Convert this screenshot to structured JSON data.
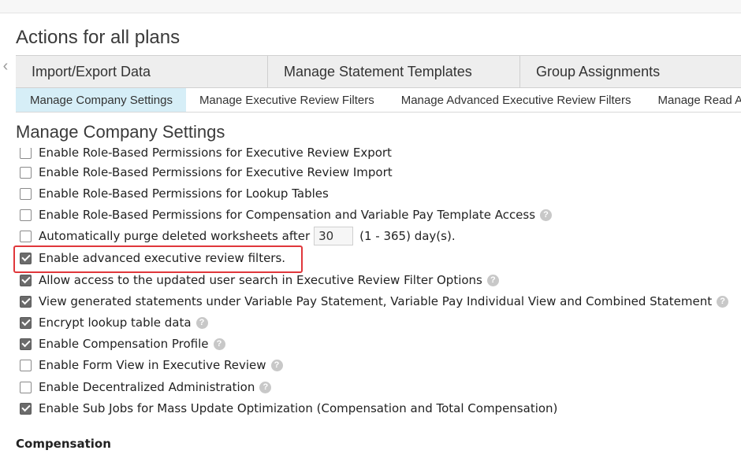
{
  "page": {
    "title": "Actions for all plans",
    "back_glyph": "‹"
  },
  "main_tabs": [
    {
      "label": "Import/Export Data"
    },
    {
      "label": "Manage Statement Templates"
    },
    {
      "label": "Group Assignments"
    }
  ],
  "sub_tabs": [
    {
      "label": "Manage Company Settings",
      "active": true
    },
    {
      "label": "Manage Executive Review Filters",
      "active": false
    },
    {
      "label": "Manage Advanced Executive Review Filters",
      "active": false
    },
    {
      "label": "Manage Read Access",
      "active": false
    }
  ],
  "section": {
    "title": "Manage Company Settings"
  },
  "settings": [
    {
      "label": "Enable Role-Based Permissions for Executive Review Export",
      "checked": false,
      "help": false
    },
    {
      "label": "Enable Role-Based Permissions for Executive Review Import",
      "checked": false,
      "help": false
    },
    {
      "label": "Enable Role-Based Permissions for Lookup Tables",
      "checked": false,
      "help": false
    },
    {
      "label": "Enable Role-Based Permissions for Compensation and Variable Pay Template Access",
      "checked": false,
      "help": true
    },
    {
      "label": "Automatically purge deleted worksheets after",
      "suffix": "(1 - 365) day(s).",
      "input_value": "30",
      "checked": false,
      "help": false
    },
    {
      "label": "Enable advanced executive review filters.",
      "checked": true,
      "help": false,
      "highlighted": true
    },
    {
      "label": "Allow access to the updated user search in Executive Review Filter Options",
      "checked": true,
      "help": true
    },
    {
      "label": "View generated statements under Variable Pay Statement, Variable Pay Individual View and Combined Statement",
      "checked": true,
      "help": true
    },
    {
      "label": "Encrypt lookup table data",
      "checked": true,
      "help": true
    },
    {
      "label": "Enable Compensation Profile",
      "checked": true,
      "help": true
    },
    {
      "label": "Enable Form View in Executive Review",
      "checked": false,
      "help": true
    },
    {
      "label": "Enable Decentralized Administration",
      "checked": false,
      "help": true
    },
    {
      "label": "Enable Sub Jobs for Mass Update Optimization (Compensation and Total Compensation)",
      "checked": true,
      "help": false
    }
  ],
  "help_glyph": "?",
  "compensation": {
    "heading": "Compensation"
  },
  "colors": {
    "highlight": "#e0373b",
    "active_subtab": "#d6eef7",
    "checkbox_checked": "#6b6b6b"
  }
}
